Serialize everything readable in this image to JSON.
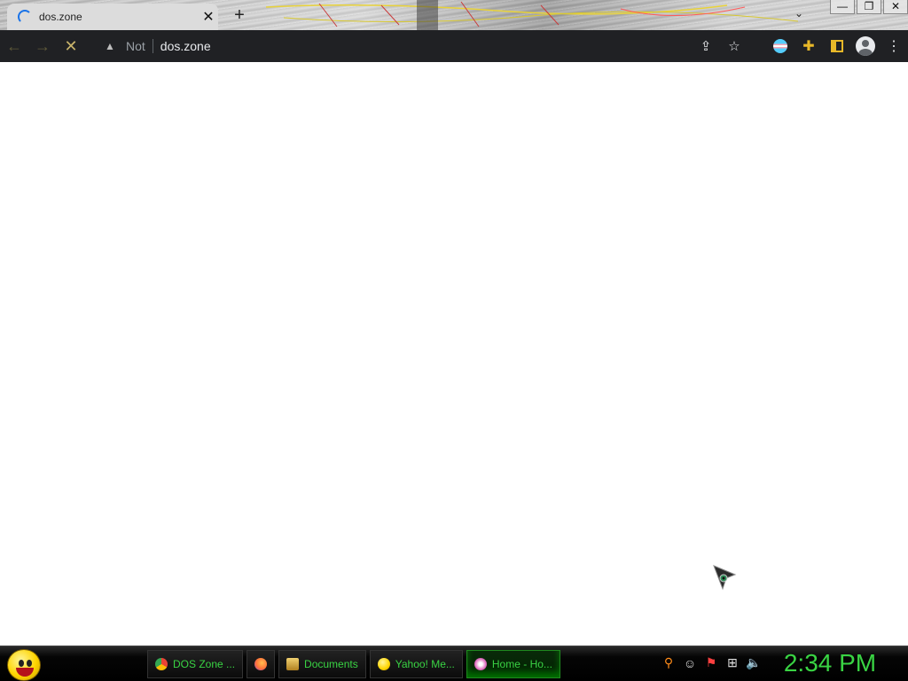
{
  "browser": {
    "tab": {
      "title": "dos.zone",
      "close_glyph": "✕"
    },
    "new_tab_glyph": "+",
    "tab_search_glyph": "⌄",
    "window_controls": {
      "minimize": "—",
      "restore": "❐",
      "close": "✕"
    },
    "toolbar": {
      "back_glyph": "←",
      "forward_glyph": "→",
      "stop_glyph": "✕",
      "security_label": "Not",
      "url": "dos.zone",
      "share_glyph": "⇪",
      "bookmark_glyph": "☆",
      "extensions_glyph": "✚",
      "menu_glyph": "⋮"
    }
  },
  "taskbar": {
    "tasks": [
      {
        "label": "DOS Zone ...",
        "icon": "chrome-icon",
        "color": "#4285f4"
      },
      {
        "label": "",
        "icon": "firefox-icon",
        "color": "#ff7139"
      },
      {
        "label": "Documents",
        "icon": "documents-icon",
        "color": "#e0b040"
      },
      {
        "label": "Yahoo! Me...",
        "icon": "yahoo-messenger-icon",
        "color": "#ffd500"
      },
      {
        "label": "Home - Ho...",
        "icon": "home-icon",
        "color": "#e070c0"
      }
    ],
    "tray": {
      "search_glyph": "⚲",
      "messenger_glyph": "☺",
      "flag_glyph": "⚑",
      "network_glyph": "⊞",
      "volume_glyph": "🔈"
    },
    "clock": "2:34 PM"
  },
  "colors": {
    "accent": "#39d343",
    "toolbar_bg": "#202124",
    "stop_icon": "#c9b46b",
    "extensions_icon": "#e8b829"
  }
}
